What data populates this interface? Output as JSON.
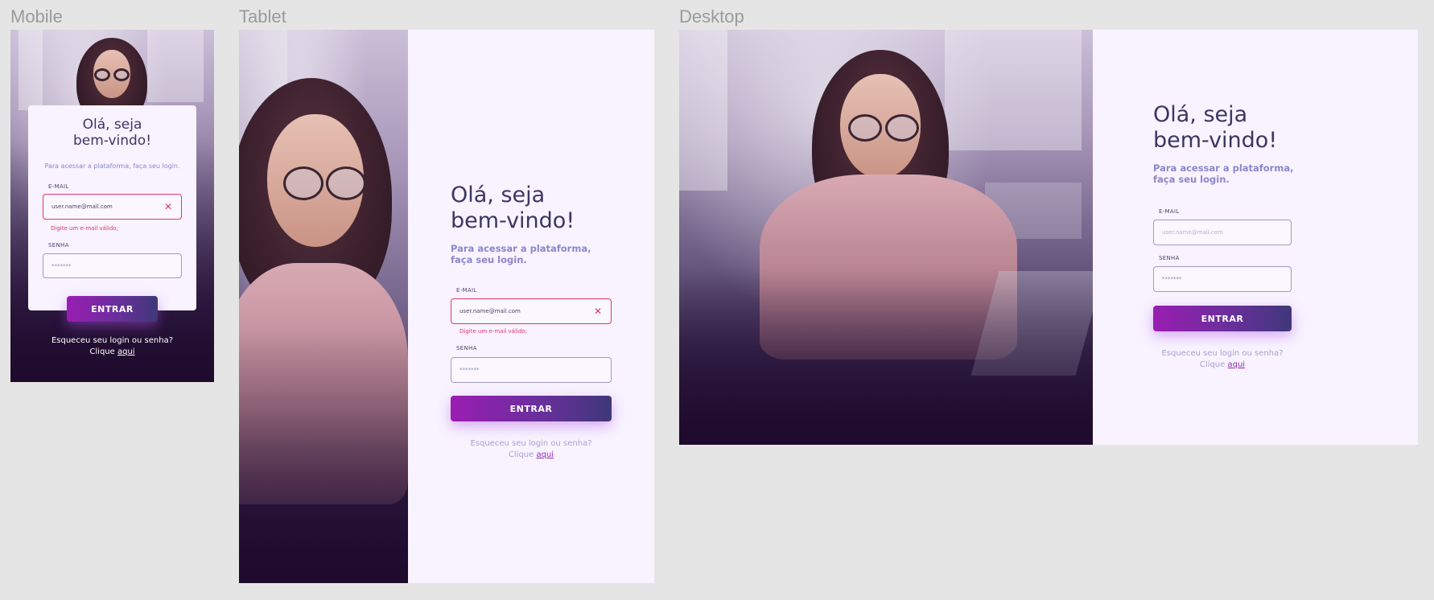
{
  "frames": {
    "mobile_label": "Mobile",
    "tablet_label": "Tablet",
    "desktop_label": "Desktop"
  },
  "login": {
    "title_line1": "Olá, seja",
    "title_line2": "bem-vindo!",
    "subtitle_mobile": "Para acessar a plataforma, faça seu login.",
    "subtitle_line1": "Para acessar a plataforma,",
    "subtitle_line2": "faça seu login.",
    "email_label": "E-MAIL",
    "email_value": "user.name@mail.com",
    "email_placeholder": "user.name@mail.com",
    "email_error": "Digite um e-mail válido;",
    "password_label": "SENHA",
    "password_value": "*******",
    "submit_label": "ENTRAR",
    "forgot_text": "Esqueceu seu login ou senha?",
    "click_text": "Clique",
    "click_link": "aqui",
    "clear_icon": "close-icon"
  },
  "colors": {
    "accent": "#9a1db2",
    "error": "#e0356b",
    "title": "#3b3663",
    "subtitle": "#8c86cc",
    "panel_bg": "#f8f3ff",
    "canvas_bg": "#e5e5e5"
  }
}
